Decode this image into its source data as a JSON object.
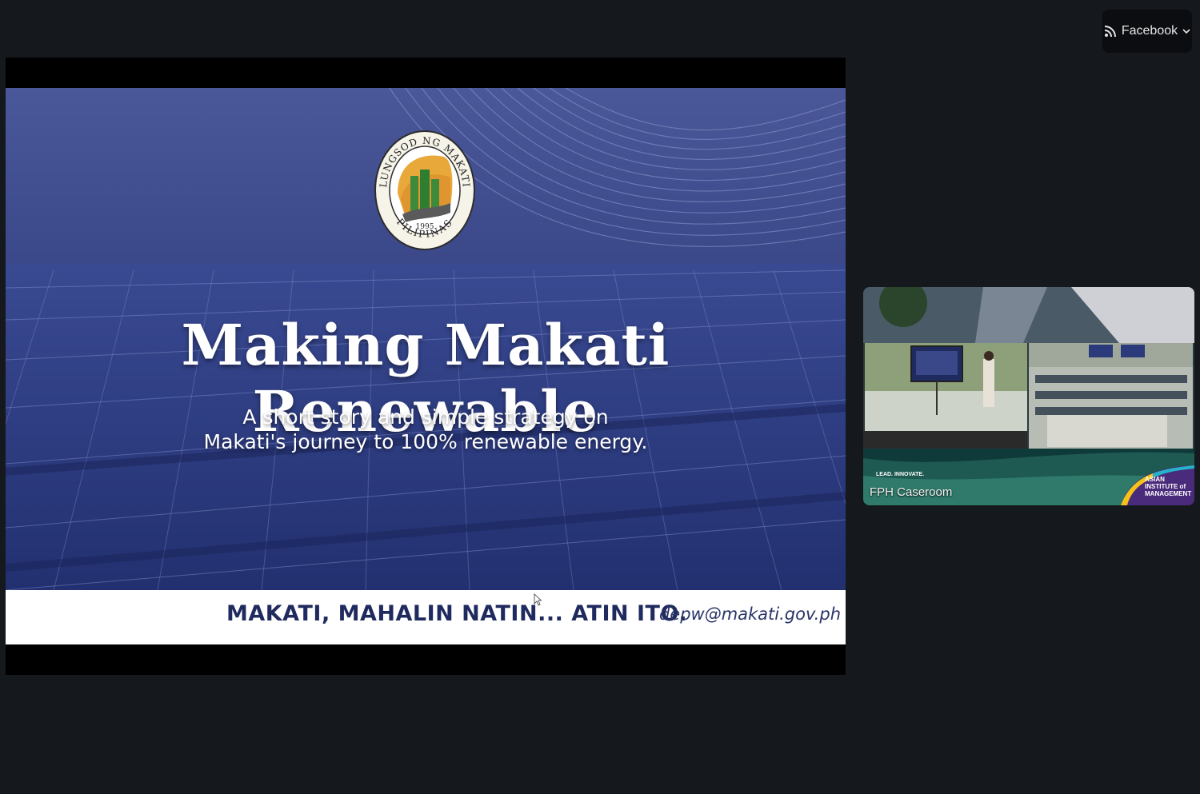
{
  "stream": {
    "label": "Facebook",
    "icon": "rss-icon",
    "chevron": "chevron-down-icon"
  },
  "slide": {
    "title": "Making Makati Renewable",
    "subtitle_line1": "A short story and simple strategy on",
    "subtitle_line2": "Makati's journey to 100% renewable energy.",
    "slogan": "MAKATI, MAHALIN NATIN... ATIN ITO.",
    "email": "depw@makati.gov.ph",
    "seal": {
      "top_text": "LUNGSOD NG MAKATI",
      "bottom_text": "PILIPINAS",
      "year": "1995"
    }
  },
  "participant": {
    "name": "FPH Caseroom",
    "overlay_tagline": "LEAD. INNOVATE.",
    "logo_text": "ASIAN INSTITUTE of MANAGEMENT"
  },
  "colors": {
    "background": "#15181c",
    "slide_blue": "#34407f",
    "slogan": "#1f2a5e"
  }
}
